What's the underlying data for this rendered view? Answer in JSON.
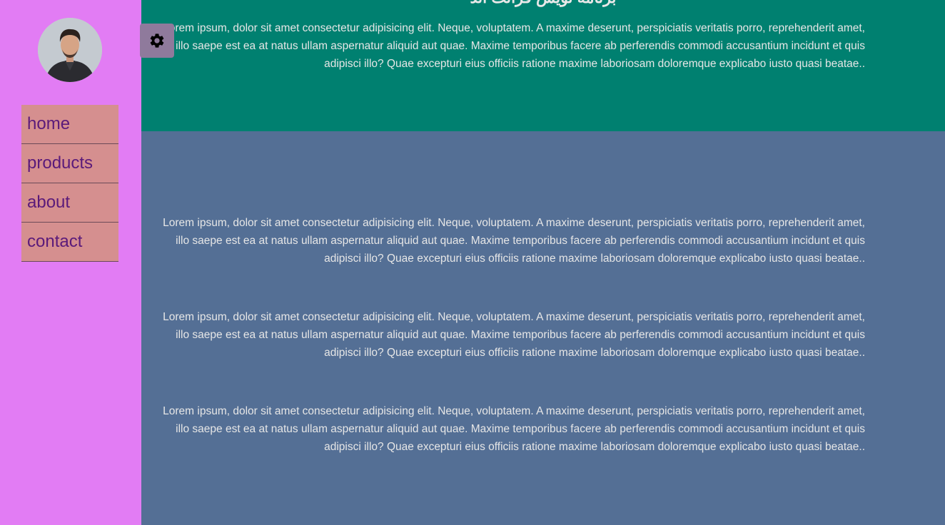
{
  "sidebar": {
    "nav": [
      "home",
      "products",
      "about",
      "contact"
    ]
  },
  "hero": {
    "title": "برنامه نویس فرانت اند",
    "text": "Lorem ipsum, dolor sit amet consectetur adipisicing elit. Neque, voluptatem. A maxime deserunt, perspiciatis veritatis porro, reprehenderit amet, illo saepe est ea at natus ullam aspernatur aliquid aut quae. Maxime temporibus facere ab perferendis commodi accusantium incidunt et quis adipisci illo? Quae excepturi eius officiis ratione maxime laboriosam doloremque explicabo iusto quasi beatae.."
  },
  "main": {
    "paragraphs": [
      "Lorem ipsum, dolor sit amet consectetur adipisicing elit. Neque, voluptatem. A maxime deserunt, perspiciatis veritatis porro, reprehenderit amet, illo saepe est ea at natus ullam aspernatur aliquid aut quae. Maxime temporibus facere ab perferendis commodi accusantium incidunt et quis adipisci illo? Quae excepturi eius officiis ratione maxime laboriosam doloremque explicabo iusto quasi beatae..",
      "Lorem ipsum, dolor sit amet consectetur adipisicing elit. Neque, voluptatem. A maxime deserunt, perspiciatis veritatis porro, reprehenderit amet, illo saepe est ea at natus ullam aspernatur aliquid aut quae. Maxime temporibus facere ab perferendis commodi accusantium incidunt et quis adipisci illo? Quae excepturi eius officiis ratione maxime laboriosam doloremque explicabo iusto quasi beatae..",
      "Lorem ipsum, dolor sit amet consectetur adipisicing elit. Neque, voluptatem. A maxime deserunt, perspiciatis veritatis porro, reprehenderit amet, illo saepe est ea at natus ullam aspernatur aliquid aut quae. Maxime temporibus facere ab perferendis commodi accusantium incidunt et quis adipisci illo? Quae excepturi eius officiis ratione maxime laboriosam doloremque explicabo iusto quasi beatae.."
    ]
  },
  "icons": {
    "settings": "gear-icon",
    "avatar": "profile-photo"
  },
  "colors": {
    "sidebar": "#e27cf4",
    "nav_item": "#d58f8f",
    "nav_text": "#5a1a7a",
    "hero": "#008070",
    "main": "#546f95",
    "settings_button": "#8f7a9c"
  }
}
